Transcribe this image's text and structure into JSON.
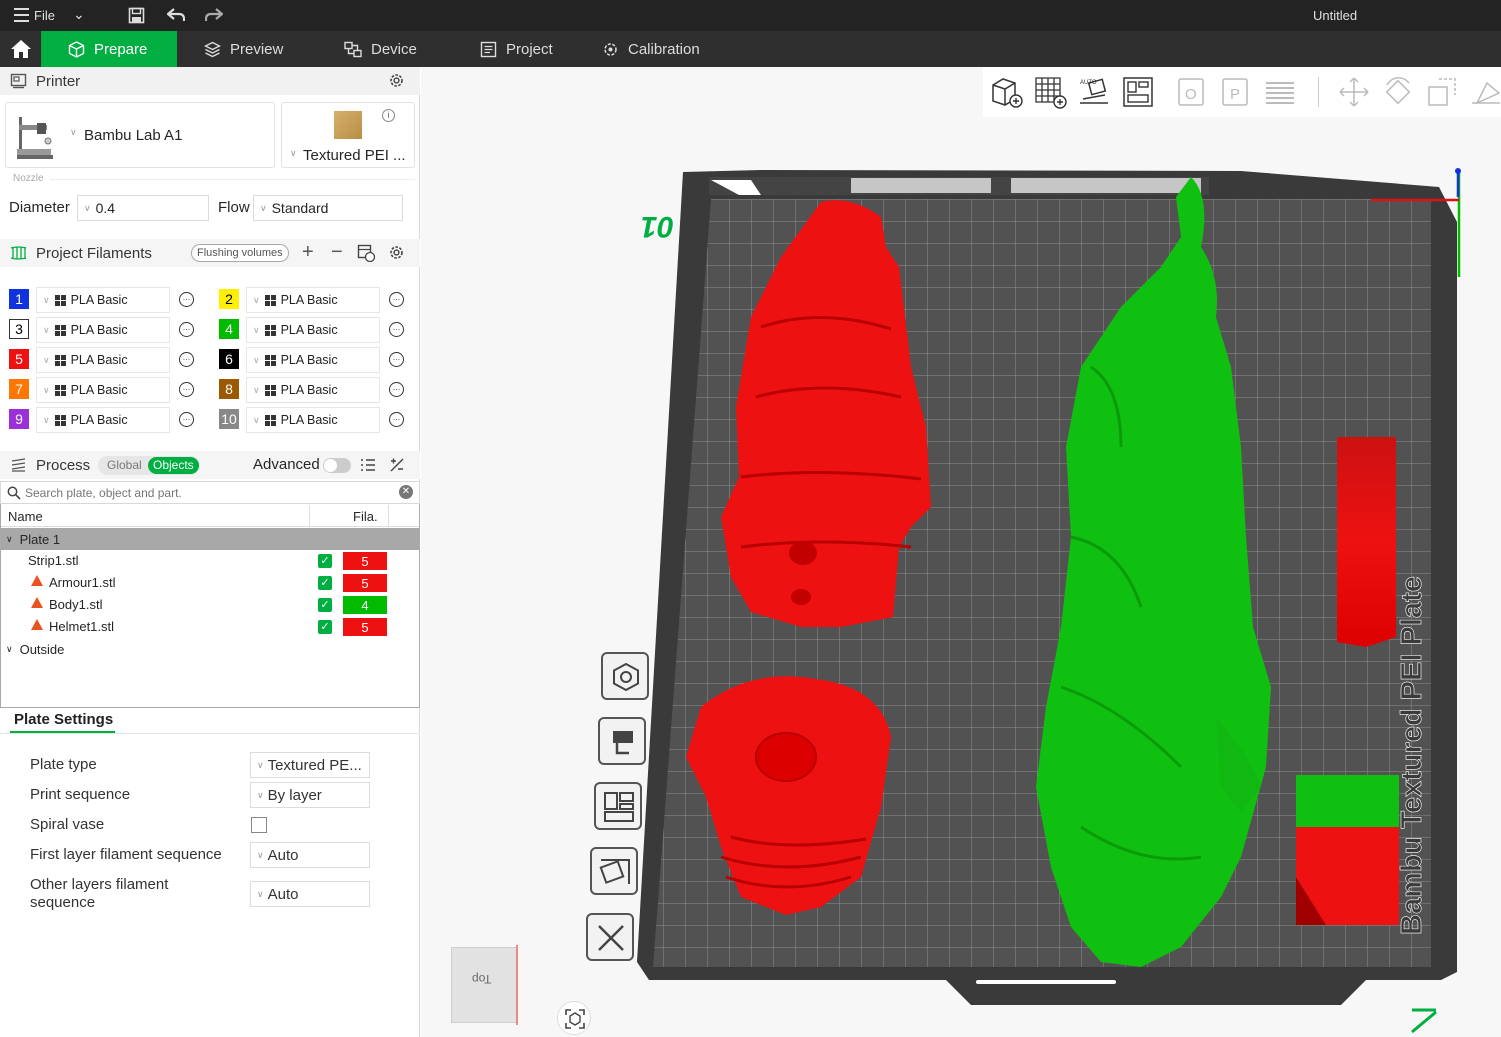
{
  "titlebar": {
    "file_label": "File",
    "window_title": "Untitled"
  },
  "tabs": [
    {
      "label": "Prepare",
      "active": true
    },
    {
      "label": "Preview"
    },
    {
      "label": "Device"
    },
    {
      "label": "Project"
    },
    {
      "label": "Calibration"
    }
  ],
  "printer": {
    "section_title": "Printer",
    "model": "Bambu Lab A1",
    "plate": "Textured PEI ...",
    "nozzle_group": "Nozzle",
    "diameter_label": "Diameter",
    "diameter_value": "0.4",
    "flow_label": "Flow",
    "flow_value": "Standard"
  },
  "filaments": {
    "section_title": "Project Filaments",
    "flushing_button": "Flushing volumes",
    "items": [
      {
        "num": "1",
        "color": "#1133dd",
        "name": "PLA Basic"
      },
      {
        "num": "2",
        "color": "#ffef00",
        "name": "PLA Basic",
        "dark_text": true
      },
      {
        "num": "3",
        "color": "#ffffff",
        "name": "PLA Basic",
        "dark_text": true
      },
      {
        "num": "4",
        "color": "#00bb00",
        "name": "PLA Basic"
      },
      {
        "num": "5",
        "color": "#ee1111",
        "name": "PLA Basic"
      },
      {
        "num": "6",
        "color": "#000000",
        "name": "PLA Basic"
      },
      {
        "num": "7",
        "color": "#ff7700",
        "name": "PLA Basic"
      },
      {
        "num": "8",
        "color": "#9b5a00",
        "name": "PLA Basic"
      },
      {
        "num": "9",
        "color": "#9b2fd8",
        "name": "PLA Basic"
      },
      {
        "num": "10",
        "color": "#888888",
        "name": "PLA Basic"
      }
    ]
  },
  "process": {
    "section_title": "Process",
    "global_label": "Global",
    "objects_label": "Objects",
    "advanced_label": "Advanced",
    "search_placeholder": "Search plate, object and part."
  },
  "object_list": {
    "col_name": "Name",
    "col_fila": "Fila.",
    "plate": "Plate 1",
    "objects": [
      {
        "name": "Strip1.stl",
        "warning": false,
        "fila": "5",
        "fila_color": "#ee1111"
      },
      {
        "name": "Armour1.stl",
        "warning": true,
        "fila": "5",
        "fila_color": "#ee1111"
      },
      {
        "name": "Body1.stl",
        "warning": true,
        "fila": "4",
        "fila_color": "#00bb00"
      },
      {
        "name": "Helmet1.stl",
        "warning": true,
        "fila": "5",
        "fila_color": "#ee1111"
      }
    ],
    "outside": "Outside"
  },
  "plate_settings": {
    "title": "Plate Settings",
    "plate_type_label": "Plate type",
    "plate_type_value": "Textured PE...",
    "print_sequence_label": "Print sequence",
    "print_sequence_value": "By layer",
    "spiral_vase_label": "Spiral vase",
    "first_layer_label": "First layer filament sequence",
    "first_layer_value": "Auto",
    "other_layers_label_1": "Other layers filament",
    "other_layers_label_2": "sequence",
    "other_layers_value": "Auto"
  },
  "viewport": {
    "plate_number": "01",
    "plate_text": "Bambu Textured PEI Plate",
    "plate_name_text": "Bambu Textured PEI Plate",
    "accent": "#00ae42",
    "view_cube_label": "Top"
  }
}
